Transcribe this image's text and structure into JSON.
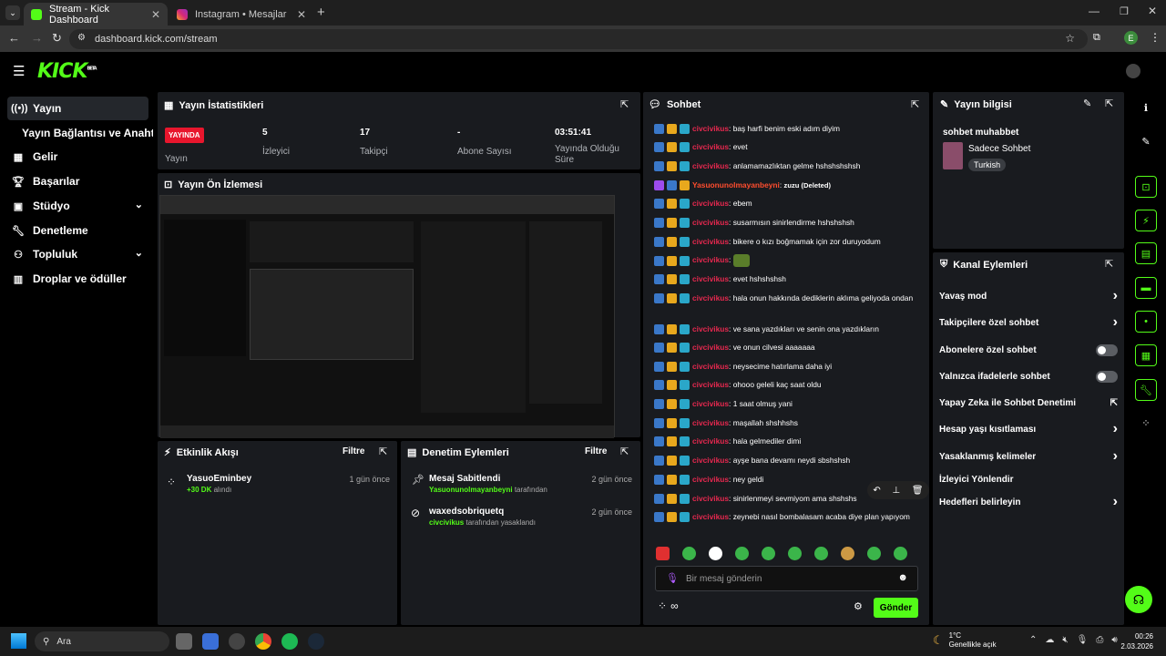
{
  "browser": {
    "tabs": [
      {
        "title": "Stream - Kick Dashboard",
        "active": true
      },
      {
        "title": "Instagram • Mesajlar",
        "active": false
      }
    ],
    "url": "dashboard.kick.com/stream",
    "profile_initial": "E"
  },
  "brand": {
    "logo": "KICK",
    "logo_sup": "BETA",
    "accent": "#53fc18"
  },
  "sidebar": {
    "items": [
      {
        "label": "Yayın",
        "icon": "broadcast-icon"
      },
      {
        "label": "Yayın Bağlantısı ve Anahtarı",
        "icon": ""
      },
      {
        "label": "Gelir",
        "icon": "revenue-icon"
      },
      {
        "label": "Başarılar",
        "icon": "trophy-icon"
      },
      {
        "label": "Stüdyo",
        "icon": "studio-icon"
      },
      {
        "label": "Denetleme",
        "icon": "wrench-icon"
      },
      {
        "label": "Topluluk",
        "icon": "community-icon"
      },
      {
        "label": "Droplar ve ödüller",
        "icon": "drops-icon"
      }
    ]
  },
  "stats": {
    "title": "Yayın İstatistikleri",
    "live_badge": "YAYINDA",
    "items": [
      {
        "value": "5",
        "label": "İzleyici"
      },
      {
        "value": "17",
        "label": "Takipçi"
      },
      {
        "value": "-",
        "label": "Abone Sayısı"
      },
      {
        "value": "03:51:41",
        "label": "Yayında Olduğu Süre"
      }
    ],
    "live_label": "Yayın"
  },
  "preview": {
    "title": "Yayın Ön İzlemesi"
  },
  "activity": {
    "title": "Etkinlik Akışı",
    "filter": "Filtre",
    "events": [
      {
        "user": "YasuoEminbey",
        "detail": "+30 DK",
        "detail_suffix": "alındı",
        "time": "1 gün önce"
      }
    ]
  },
  "moderation": {
    "title": "Denetim Eylemleri",
    "filter": "Filtre",
    "events": [
      {
        "title": "Mesaj Sabitlendi",
        "actor": "Yasuonunolmayanbeyni",
        "suffix": "tarafından",
        "time": "2 gün önce"
      },
      {
        "title": "waxedsobriquetq",
        "actor": "civcivikus",
        "suffix": "tarafından yasaklandı",
        "time": "2 gün önce"
      }
    ]
  },
  "chat": {
    "title": "Sohbet",
    "messages": [
      {
        "user": "civcivikus",
        "text": "baş harfi benim eski adım diyim"
      },
      {
        "user": "civcivikus",
        "text": "evet"
      },
      {
        "user": "civcivikus",
        "text": "anlamamazlıktan gelme hshshshshsh"
      },
      {
        "user": "Yasuonunolmayanbeyni",
        "text": "zuzu (Deleted)"
      },
      {
        "user": "civcivikus",
        "text": "ebem"
      },
      {
        "user": "civcivikus",
        "text": "susarmısın sinirlendirme hshshshsh"
      },
      {
        "user": "civcivikus",
        "text": "bikere o kızı boğmamak için zor duruyodum"
      },
      {
        "user": "civcivikus",
        "text": ""
      },
      {
        "user": "civcivikus",
        "text": "evet hshshshsh"
      },
      {
        "user": "civcivikus",
        "text": "hala onun hakkında dediklerin aklıma geliyoda ondan"
      },
      {
        "user": "civcivikus",
        "text": "ve sana yazdıkları ve senin ona yazdıkların"
      },
      {
        "user": "civcivikus",
        "text": "ve onun cilvesi aaaaaaa"
      },
      {
        "user": "civcivikus",
        "text": "neysecime hatırlama daha iyi"
      },
      {
        "user": "civcivikus",
        "text": "ohooo geleli kaç saat oldu"
      },
      {
        "user": "civcivikus",
        "text": "1 saat olmuş yani"
      },
      {
        "user": "civcivikus",
        "text": "maşallah shshhshs"
      },
      {
        "user": "civcivikus",
        "text": "hala gelmediler dimi"
      },
      {
        "user": "civcivikus",
        "text": "ayşe bana devamı neydi sbshshsh"
      },
      {
        "user": "civcivikus",
        "text": "ney geldi"
      },
      {
        "user": "civcivikus",
        "text": "sinirlenmeyi sevmiyom ama shshshs"
      },
      {
        "user": "civcivikus",
        "text": "zeynebi nasıl bombalasam acaba diye plan yapıyom"
      }
    ],
    "input_placeholder": "Bir mesaj gönderin",
    "send_label": "Gönder",
    "infinity": "∞"
  },
  "stream_info": {
    "title": "Yayın bilgisi",
    "stream_title": "sohbet muhabbet",
    "category": "Sadece Sohbet",
    "language": "Turkish"
  },
  "channel_actions": {
    "title": "Kanal Eylemleri",
    "items": [
      {
        "label": "Yavaş mod",
        "control": "chevron"
      },
      {
        "label": "Takipçilere özel sohbet",
        "control": "chevron"
      },
      {
        "label": "Abonelere özel sohbet",
        "control": "toggle"
      },
      {
        "label": "Yalnızca ifadelerle sohbet",
        "control": "toggle"
      },
      {
        "label": "Yapay Zeka ile Sohbet Denetimi",
        "control": "external"
      },
      {
        "label": "Hesap yaşı kısıtlaması",
        "control": "chevron"
      },
      {
        "label": "Yasaklanmış kelimeler",
        "control": "chevron"
      },
      {
        "label": "İzleyici Yönlendir",
        "control": "none"
      },
      {
        "label": "Hedefleri belirleyin",
        "control": "chevron"
      }
    ]
  },
  "taskbar": {
    "search": "Ara",
    "weather_temp": "1°C",
    "weather_desc": "Genellikle açık",
    "time": "00:26",
    "date": "2.03.2026"
  }
}
